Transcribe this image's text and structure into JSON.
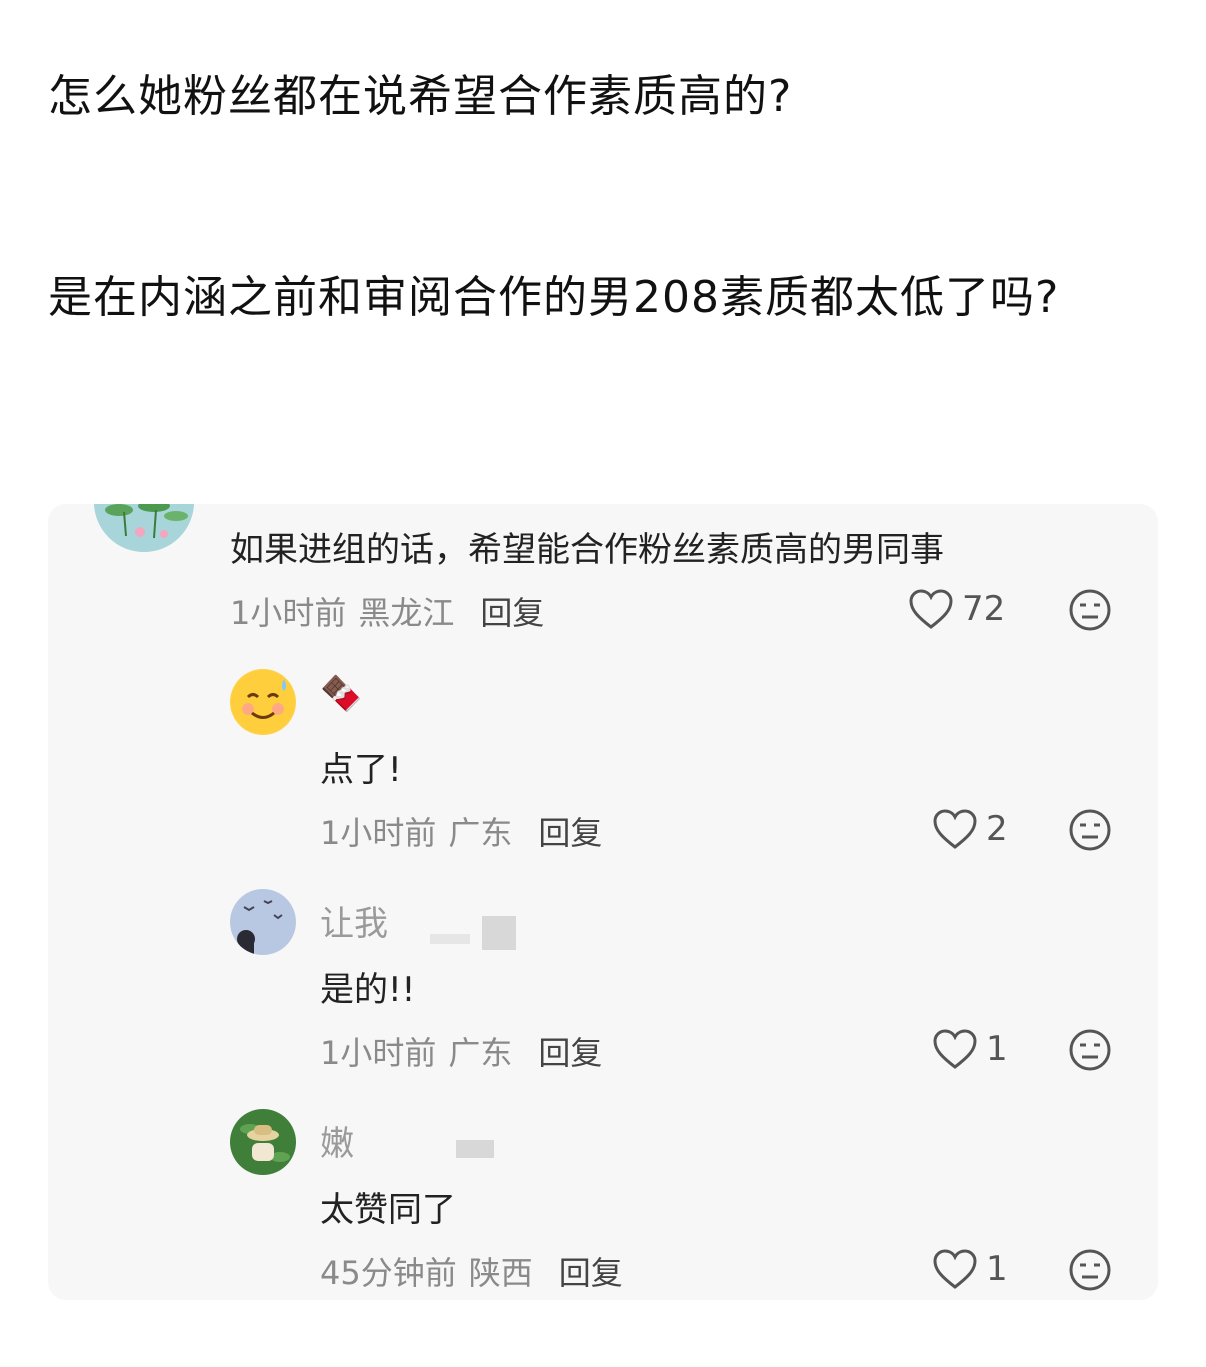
{
  "post": {
    "line1": "怎么她粉丝都在说希望合作素质高的?",
    "line2": "是在内涵之前和审阅合作的男208素质都太低了吗?"
  },
  "comments": [
    {
      "text": "如果进组的话，希望能合作粉丝素质高的男同事",
      "time": "1小时前",
      "region": "黑龙江",
      "reply": "回复",
      "likes": "72"
    },
    {
      "username": "🍫",
      "text": "点了!",
      "time": "1小时前",
      "region": "广东",
      "reply": "回复",
      "likes": "2"
    },
    {
      "username": "让我",
      "text": "是的!!",
      "time": "1小时前",
      "region": "广东",
      "reply": "回复",
      "likes": "1"
    },
    {
      "username": "嫩",
      "text": "太赞同了",
      "time": "45分钟前",
      "region": "陕西",
      "reply": "回复",
      "likes": "1"
    }
  ],
  "icons": {
    "like": "heart-outline-icon",
    "dislike": "neutral-face-icon"
  }
}
